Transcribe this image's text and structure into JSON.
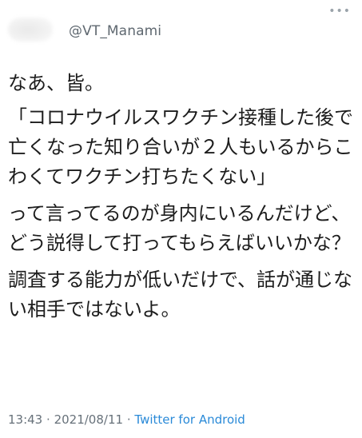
{
  "tweet": {
    "handle": "@VT_Manami",
    "more_icon": "more-horizontal-icon",
    "paragraphs": [
      "なあ、皆。",
      "「コロナウイルスワクチン接種した後で亡くなった知り合いが２人もいるからこわくてワクチン打ちたくない」",
      "って言ってるのが身内にいるんだけど、どう説得して打ってもらえばいいかな？",
      "調査する能力が低いだけで、話が通じない相手ではないよ。"
    ],
    "time": "13:43",
    "date": "2021/08/11",
    "separator": "·",
    "source": "Twitter for Android"
  },
  "colors": {
    "text": "#1d1d1d",
    "muted": "#5f6870",
    "link": "#2a8ad8"
  }
}
